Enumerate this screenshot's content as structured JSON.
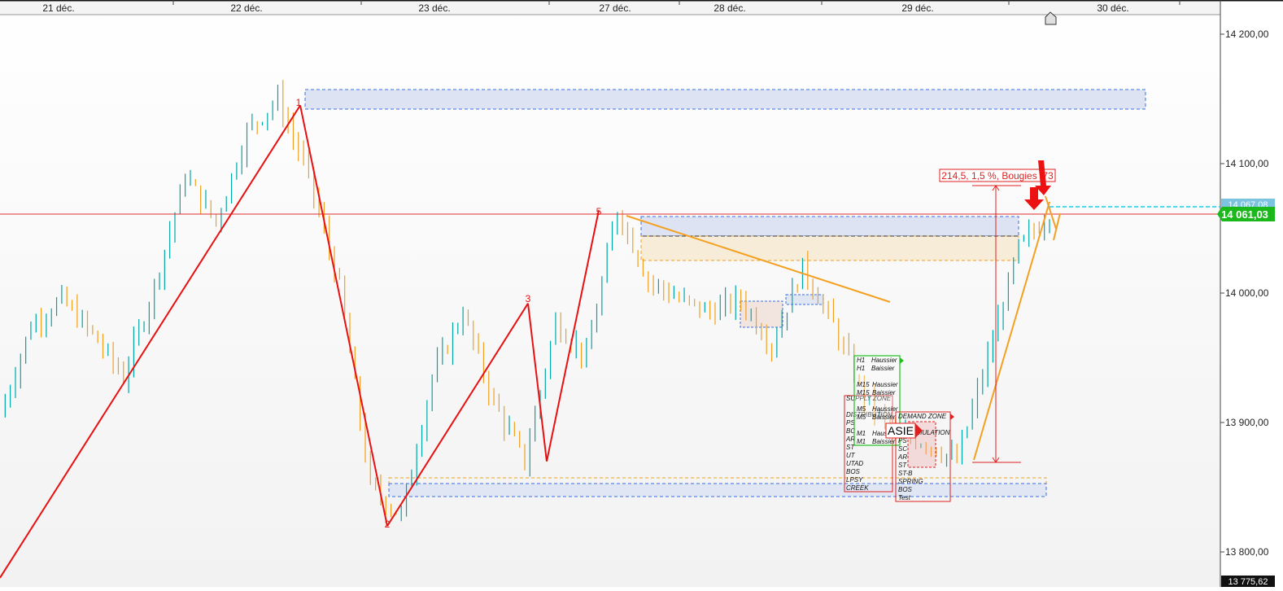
{
  "chart_data": {
    "type": "line",
    "title": "",
    "x_ticks": [
      "21 déc.",
      "22 déc.",
      "23 déc.",
      "27 déc.",
      "28 déc.",
      "29 déc.",
      "30 déc."
    ],
    "y_ticks": [
      "14 200,00",
      "14 100,00",
      "14 000,00",
      "13 900,00",
      "13 800,00"
    ],
    "y_tick_values": [
      14200,
      14100,
      14000,
      13900,
      13800
    ],
    "ylim": [
      13775.62,
      14226
    ],
    "grid": false,
    "last_price_label": "14 061,03",
    "last_price_value": 14061.03,
    "hidden_price_label": "14 067,08",
    "bottom_price_label": "13 775,62",
    "measure_label": "214,5, 1,5 %, Bougies :73",
    "zigzag_labels": [
      "1",
      "2",
      "3",
      "5"
    ],
    "zigzag": [
      {
        "x": "21 déc.",
        "y": 13780
      },
      {
        "x": "22 déc.",
        "y": 14145
      },
      {
        "x": "23 déc.",
        "y": 13820
      },
      {
        "x": "23 déc.",
        "y": 13992
      },
      {
        "x": "23 déc.",
        "y": 13870
      },
      {
        "x": "27 déc.",
        "y": 14064
      }
    ],
    "price_series": [
      {
        "x": "21 déc.",
        "y": 13905
      },
      {
        "x": "21 déc.",
        "y": 13975
      },
      {
        "x": "21 déc.",
        "y": 13995
      },
      {
        "x": "21 déc.",
        "y": 13968
      },
      {
        "x": "21 déc.",
        "y": 13935
      },
      {
        "x": "22 déc.",
        "y": 14005
      },
      {
        "x": "22 déc.",
        "y": 14090
      },
      {
        "x": "22 déc.",
        "y": 14055
      },
      {
        "x": "22 déc.",
        "y": 14125
      },
      {
        "x": "22 déc.",
        "y": 14150
      },
      {
        "x": "22 déc.",
        "y": 14090
      },
      {
        "x": "22 déc.",
        "y": 14005
      },
      {
        "x": "23 déc.",
        "y": 13850
      },
      {
        "x": "23 déc.",
        "y": 13828
      },
      {
        "x": "23 déc.",
        "y": 13935
      },
      {
        "x": "23 déc.",
        "y": 13985
      },
      {
        "x": "23 déc.",
        "y": 13915
      },
      {
        "x": "23 déc.",
        "y": 13870
      },
      {
        "x": "23 déc.",
        "y": 13978
      },
      {
        "x": "23 déc.",
        "y": 13950
      },
      {
        "x": "27 déc.",
        "y": 14065
      },
      {
        "x": "27 déc.",
        "y": 14010
      },
      {
        "x": "27 déc.",
        "y": 13995
      },
      {
        "x": "28 déc.",
        "y": 13985
      },
      {
        "x": "28 déc.",
        "y": 13995
      },
      {
        "x": "28 déc.",
        "y": 13960
      },
      {
        "x": "28 déc.",
        "y": 14020
      },
      {
        "x": "28 déc.",
        "y": 13975
      },
      {
        "x": "28 déc.",
        "y": 13920
      },
      {
        "x": "29 déc.",
        "y": 13890
      },
      {
        "x": "29 déc.",
        "y": 13885
      },
      {
        "x": "29 déc.",
        "y": 13870
      },
      {
        "x": "29 déc.",
        "y": 13950
      },
      {
        "x": "29 déc.",
        "y": 14035
      },
      {
        "x": "30 déc.",
        "y": 14062
      }
    ],
    "zones": [
      {
        "name": "supply-zone-top",
        "y_range": [
          14137,
          14153
        ],
        "style": "blue-dashed"
      },
      {
        "name": "supply-zone-mid",
        "y_range": [
          14060,
          14043
        ],
        "style": "blue-dashed"
      },
      {
        "name": "orange-zone-mid",
        "y_range": [
          14043,
          14025
        ],
        "style": "orange-dashed"
      },
      {
        "name": "demand-zone-low",
        "y_range": [
          13848,
          13838
        ],
        "style": "blue-dashed"
      }
    ]
  },
  "indicator_panels": {
    "trend": [
      "H1",
      "Haussier",
      "H1",
      "Baissier",
      "M15",
      "Haussier",
      "M15",
      "Baissier",
      "M5",
      "Haussier",
      "M5",
      "Baissier",
      "M1",
      "Haussier",
      "M1",
      "Baissier"
    ],
    "distribution": [
      "SUPPLY ZONE",
      "DISTRIBUTION",
      "PS",
      "BC",
      "AR",
      "ST",
      "UT",
      "UTAD",
      "BOS",
      "LPSY",
      "CREEK"
    ],
    "accumulation": [
      "DEMAND ZONE",
      "ACCUMULATION",
      "PS",
      "SC",
      "AR",
      "ST",
      "ST-B",
      "SPRING",
      "BOS",
      "Test"
    ],
    "session_label": "ASIE"
  },
  "colors": {
    "up": "#00a6a6",
    "down": "#f0a020",
    "zigzag": "#e81010",
    "trendline": "#f4a020",
    "last_price_bg": "#1bb81b",
    "zone_blue": "#3a6fe0",
    "zone_orange": "#f0a020",
    "price_line": "#e03030",
    "cyan_line": "#25c8e8"
  }
}
